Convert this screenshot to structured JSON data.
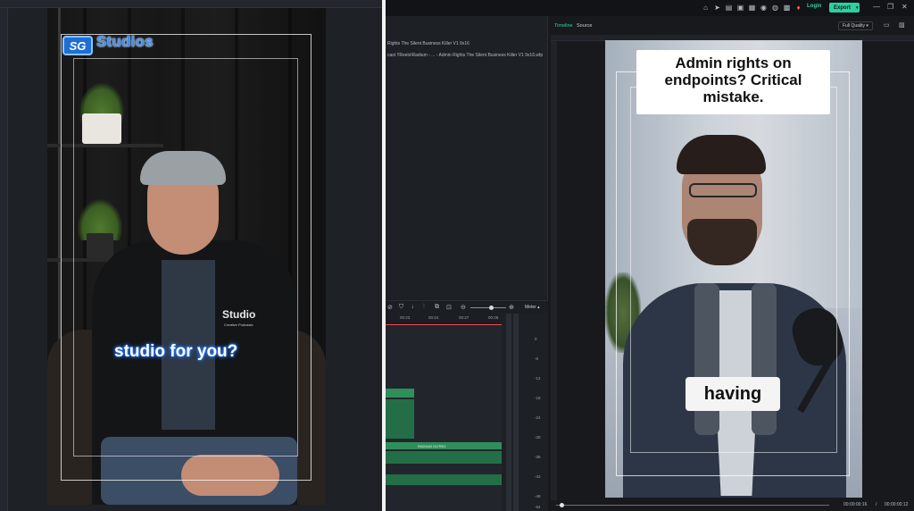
{
  "left_preview": {
    "brand_badge": "SG",
    "brand_text": "Studios",
    "caption": "studio for you?",
    "jacket_logo": "Studio",
    "jacket_logo_sub": "Creative Podcasts"
  },
  "editor": {
    "login_label": "Login",
    "export_label": "Export",
    "media": {
      "line1": "Rights The Silent Business Killer V1 9x16",
      "line2": "cast !!Reels\\Radium - ... - Admin Rights The Silent Business Killer V1 9x16.wfp"
    },
    "timeline": {
      "meter_label": "Meter",
      "ruler_ticks": [
        "00:23",
        "00:24",
        "00:27",
        "00:28"
      ],
      "clip_label": "RADIUM OUTRO",
      "db_labels": [
        "0",
        "-6",
        "-12",
        "-18",
        "-24",
        "-30",
        "-36",
        "-42",
        "-48",
        "-54"
      ]
    },
    "preview": {
      "tab_timeline": "Timeline",
      "tab_source": "Source",
      "quality": "Full Quality",
      "caption_top": "Admin rights on endpoints? Critical mistake.",
      "caption_bottom": "having",
      "time_current": "00:00:00:16",
      "time_separator": "/",
      "time_total": "00:00:00:12"
    }
  },
  "colors": {
    "accent": "#2ecfa0",
    "brand_blue": "#3c8fff",
    "playhead": "#ff4a55",
    "clip_green": "#2f8f5a"
  }
}
